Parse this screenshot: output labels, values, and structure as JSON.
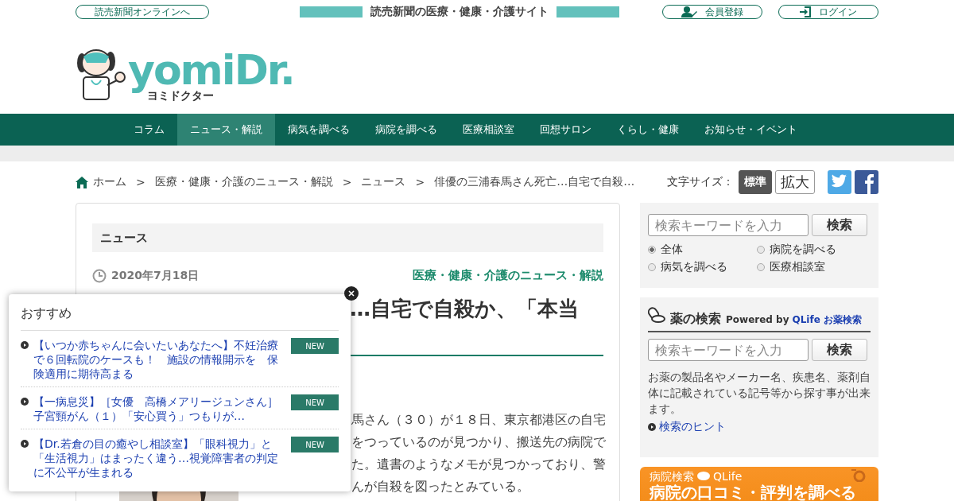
{
  "top_bar": {
    "home_link": "読売新聞オンラインへ",
    "tagline": "読売新聞の医療・健康・介護サイト",
    "buttons": [
      {
        "kind": "register",
        "label": "会員登録"
      },
      {
        "kind": "login",
        "label": "ログイン"
      }
    ]
  },
  "logo": {
    "name": "yomiDr.",
    "reading": "ヨミドクター"
  },
  "nav": [
    {
      "label": "コラム",
      "selected": false
    },
    {
      "label": "ニュース・解説",
      "selected": true
    },
    {
      "label": "病気を調べる",
      "selected": false
    },
    {
      "label": "病院を調べる",
      "selected": false
    },
    {
      "label": "医療相談室",
      "selected": false
    },
    {
      "label": "回想サロン",
      "selected": false
    },
    {
      "label": "くらし・健康",
      "selected": false
    },
    {
      "label": "お知らせ・イベント",
      "selected": false
    }
  ],
  "breadcrumb": [
    {
      "label": "ホーム"
    },
    {
      "separator": ">",
      "label": "医療・健康・介護のニュース・解説"
    },
    {
      "separator": ">",
      "label": "ニュース"
    },
    {
      "separator": ">",
      "label": "俳優の三浦春馬さん死亡…自宅で自殺…"
    }
  ],
  "font_size": {
    "label": "文字サイズ：",
    "options": [
      {
        "label": "標準",
        "selected": true
      },
      {
        "label": "拡大",
        "selected": false
      }
    ]
  },
  "article": {
    "section": "ニュース",
    "date": "2020年7月18日",
    "category": "医療・健康・介護のニュース・解説",
    "title": "…自宅で自殺か、「本当",
    "body_lines": [
      "馬さん（３０）が１８日、東京都港区の自宅",
      "をつっているのが見つかり、搬送先の病院で",
      "た。遺書のようなメモが見つかっており、警",
      "んが自殺を図ったとみている。"
    ]
  },
  "recommend_popup": {
    "title": "おすすめ",
    "items": [
      {
        "text": "【いつか赤ちゃんに会いたいあなたへ】不妊治療で６回転院のケースも！　施設の情報開示を　保険適用に期待高まる",
        "badge": "NEW"
      },
      {
        "text": "【一病息災】［女優　高橋メアリージュンさん］子宮頸がん（１）「安心買う」つもりが…",
        "badge": "NEW"
      },
      {
        "text": "【Dr.若倉の目の癒やし相談室】「眼科視力」と「生活視力」はまったく違う…視覚障害者の判定に不公平が生まれる",
        "badge": "NEW"
      }
    ]
  },
  "site_search": {
    "placeholder": "検索キーワードを入力",
    "button": "検索",
    "scopes": [
      {
        "label": "全体",
        "selected": true
      },
      {
        "label": "病院を調べる",
        "selected": false
      },
      {
        "label": "病気を調べる",
        "selected": false
      },
      {
        "label": "医療相談室",
        "selected": false
      }
    ]
  },
  "drug_search": {
    "title": "薬の検索",
    "powered_by": "Powered by",
    "provider": "QLife お薬検索",
    "placeholder": "検索キーワードを入力",
    "button": "検索",
    "description": "お薬の製品名やメーカー名、疾患名、薬剤自体に記載されている記号等から探す事が出来ます。",
    "hint_link": "検索のヒント"
  },
  "hospital_banner": {
    "label": "病院検索",
    "provider": "QLife",
    "headline": "病院の口コミ・評判を調べる"
  }
}
